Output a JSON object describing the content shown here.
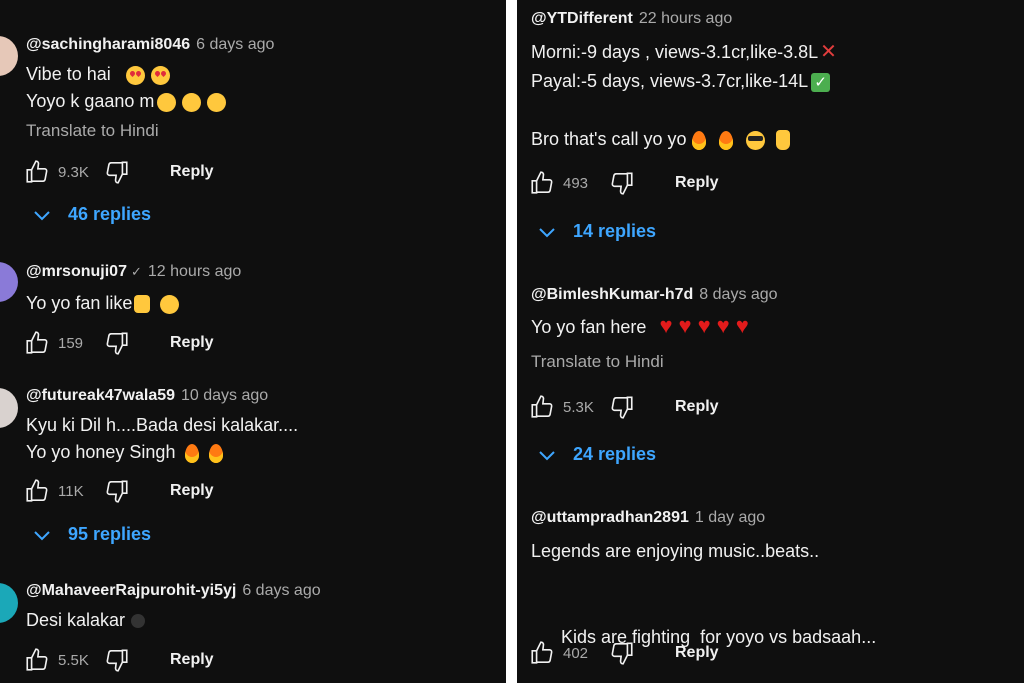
{
  "left_comments": [
    {
      "username": "@sachingharami8046",
      "time": "6 days ago",
      "lines": [
        "Vibe to hai",
        "Yoyo k gaano m"
      ],
      "translate": "Translate to Hindi",
      "likes": "9.3K",
      "reply": "Reply",
      "replies": "46 replies"
    },
    {
      "username": "@mrsonuji07",
      "verified_icon": "check-icon",
      "time": "12 hours ago",
      "lines": [
        "Yo yo fan like"
      ],
      "likes": "159",
      "reply": "Reply"
    },
    {
      "username": "@futureak47wala59",
      "time": "10 days ago",
      "lines": [
        "Kyu ki Dil h....Bada desi kalakar....",
        "Yo yo honey Singh"
      ],
      "likes": "11K",
      "reply": "Reply",
      "replies": "95 replies"
    },
    {
      "username": "@MahaveerRajpurohit-yi5yj",
      "time": "6 days ago",
      "lines": [
        "Desi kalakar"
      ],
      "likes": "5.5K",
      "reply": "Reply"
    }
  ],
  "right_comments": [
    {
      "username": "@YTDifferent",
      "time": "22 hours ago",
      "lines": [
        "Morni:-9 days , views-3.1cr,like-3.8L",
        "Payal:-5 days, views-3.7cr,like-14L",
        "Bro that's call yo yo"
      ],
      "likes": "493",
      "reply": "Reply",
      "replies": "14 replies"
    },
    {
      "username": "@BimleshKumar-h7d",
      "time": "8 days ago",
      "lines": [
        "Yo yo fan here"
      ],
      "translate": "Translate to Hindi",
      "likes": "5.3K",
      "reply": "Reply",
      "replies": "24 replies"
    },
    {
      "username": "@uttampradhan2891",
      "time": "1 day ago",
      "lines": [
        "Legends are enjoying music..beats..",
        "Kids are fighting  for yoyo vs badsaah..."
      ],
      "likes": "402",
      "reply": "Reply"
    }
  ],
  "icons": {
    "like": "thumbs-up-icon",
    "dislike": "thumbs-down-icon",
    "expand": "chevron-down-icon"
  },
  "colors": {
    "background": "#0f0f0f",
    "primary_text": "#f1f1f1",
    "secondary_text": "#aaaaaa",
    "link_blue": "#3ea6ff"
  }
}
